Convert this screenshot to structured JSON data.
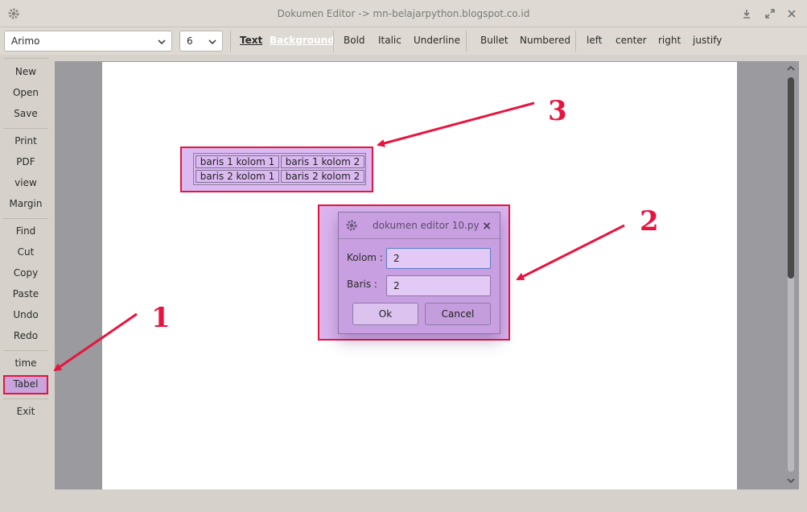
{
  "window": {
    "title": "Dokumen Editor -> mn-belajarpython.blogspot.co.id"
  },
  "toolbar": {
    "font": "Arimo",
    "size": "6",
    "text_tab": "Text",
    "background_tab": "Background",
    "bold": "Bold",
    "italic": "Italic",
    "underline": "Underline",
    "bullet": "Bullet",
    "numbered": "Numbered",
    "left": "left",
    "center": "center",
    "right": "right",
    "justify": "justify"
  },
  "sidebar": {
    "items": [
      "New",
      "Open",
      "Save",
      "Print",
      "PDF",
      "view",
      "Margin",
      "Find",
      "Cut",
      "Copy",
      "Paste",
      "Undo",
      "Redo",
      "time",
      "Tabel",
      "Exit"
    ],
    "active": "Tabel"
  },
  "table": {
    "rows": [
      [
        "baris 1 kolom 1",
        "baris 1 kolom 2"
      ],
      [
        "baris 2 kolom 1",
        "baris 2 kolom 2"
      ]
    ]
  },
  "dialog": {
    "title": "dokumen editor 10.py",
    "close": "×",
    "kolom_label": "Kolom :",
    "kolom_value": "2",
    "baris_label": "Baris   :",
    "baris_value": "2",
    "ok": "Ok",
    "cancel": "Cancel"
  },
  "annotations": {
    "one": "1",
    "two": "2",
    "three": "3"
  },
  "colors": {
    "highlight": "#e8143f",
    "accent": "#c9a3dc",
    "dialog_bg": "#c89fe0"
  }
}
